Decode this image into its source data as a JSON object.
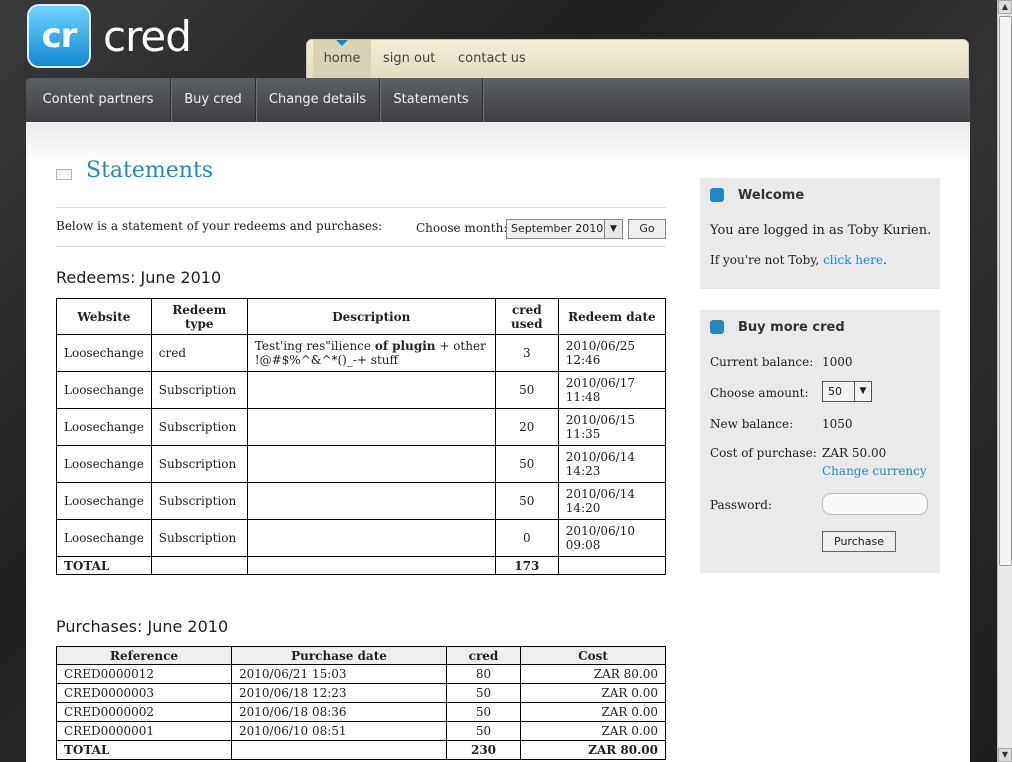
{
  "logo": {
    "badge": "cr",
    "name": "cred"
  },
  "top_nav": {
    "home": "home",
    "sign_out": "sign out",
    "contact": "contact us"
  },
  "main_nav": [
    "Content partners",
    "Buy cred",
    "Change details",
    "Statements"
  ],
  "page": {
    "title": "Statements",
    "intro": "Below is a statement of your redeems and purchases:",
    "month_label": "Choose month:",
    "month_value": "September 2010",
    "go": "Go"
  },
  "redeems": {
    "heading": "Redeems: June 2010",
    "headers": [
      "Website",
      "Redeem type",
      "Description",
      "cred used",
      "Redeem date"
    ],
    "rows": [
      {
        "website": "Loosechange",
        "type": "cred",
        "description": "Test'ing res\"ilience of plugin + other !@#$%^&^*()_-+ stuff",
        "used": "3",
        "date": "2010/06/25 12:46"
      },
      {
        "website": "Loosechange",
        "type": "Subscription",
        "description": "",
        "used": "50",
        "date": "2010/06/17 11:48"
      },
      {
        "website": "Loosechange",
        "type": "Subscription",
        "description": "",
        "used": "20",
        "date": "2010/06/15 11:35"
      },
      {
        "website": "Loosechange",
        "type": "Subscription",
        "description": "",
        "used": "50",
        "date": "2010/06/14 14:23"
      },
      {
        "website": "Loosechange",
        "type": "Subscription",
        "description": "",
        "used": "50",
        "date": "2010/06/14 14:20"
      },
      {
        "website": "Loosechange",
        "type": "Subscription",
        "description": "",
        "used": "0",
        "date": "2010/06/10 09:08"
      }
    ],
    "total_label": "TOTAL",
    "total_used": "173"
  },
  "purchases": {
    "heading": "Purchases: June 2010",
    "headers": [
      "Reference",
      "Purchase date",
      "cred",
      "Cost"
    ],
    "rows": [
      {
        "ref": "CRED0000012",
        "date": "2010/06/21 15:03",
        "cred": "80",
        "cost": "ZAR 80.00"
      },
      {
        "ref": "CRED0000003",
        "date": "2010/06/18 12:23",
        "cred": "50",
        "cost": "ZAR 0.00"
      },
      {
        "ref": "CRED0000002",
        "date": "2010/06/18 08:36",
        "cred": "50",
        "cost": "ZAR 0.00"
      },
      {
        "ref": "CRED0000001",
        "date": "2010/06/10 08:51",
        "cred": "50",
        "cost": "ZAR 0.00"
      }
    ],
    "total_label": "TOTAL",
    "total_cred": "230",
    "total_cost": "ZAR 80.00"
  },
  "welcome": {
    "title": "Welcome",
    "logged_in": "You are logged in as Toby Kurien.",
    "not_user": "If you're not Toby,",
    "click_here": "click here",
    "period": "."
  },
  "buy": {
    "title": "Buy more cred",
    "balance_label": "Current balance:",
    "balance_value": "1000",
    "amount_label": "Choose amount:",
    "amount_value": "50",
    "new_balance_label": "New balance:",
    "new_balance_value": "1050",
    "cost_label": "Cost of purchase:",
    "cost_value": "ZAR 50.00",
    "change_currency": "Change currency",
    "password_label": "Password:",
    "purchase": "Purchase"
  },
  "colors": {
    "accent": "#1e8bc3",
    "nav_dark": "#4a4c50",
    "nav_light": "#efe9d0"
  },
  "icons": [
    "book-icon",
    "folder-icon",
    "dropdown-arrow-icon",
    "scroll-up-icon",
    "scroll-down-icon"
  ]
}
